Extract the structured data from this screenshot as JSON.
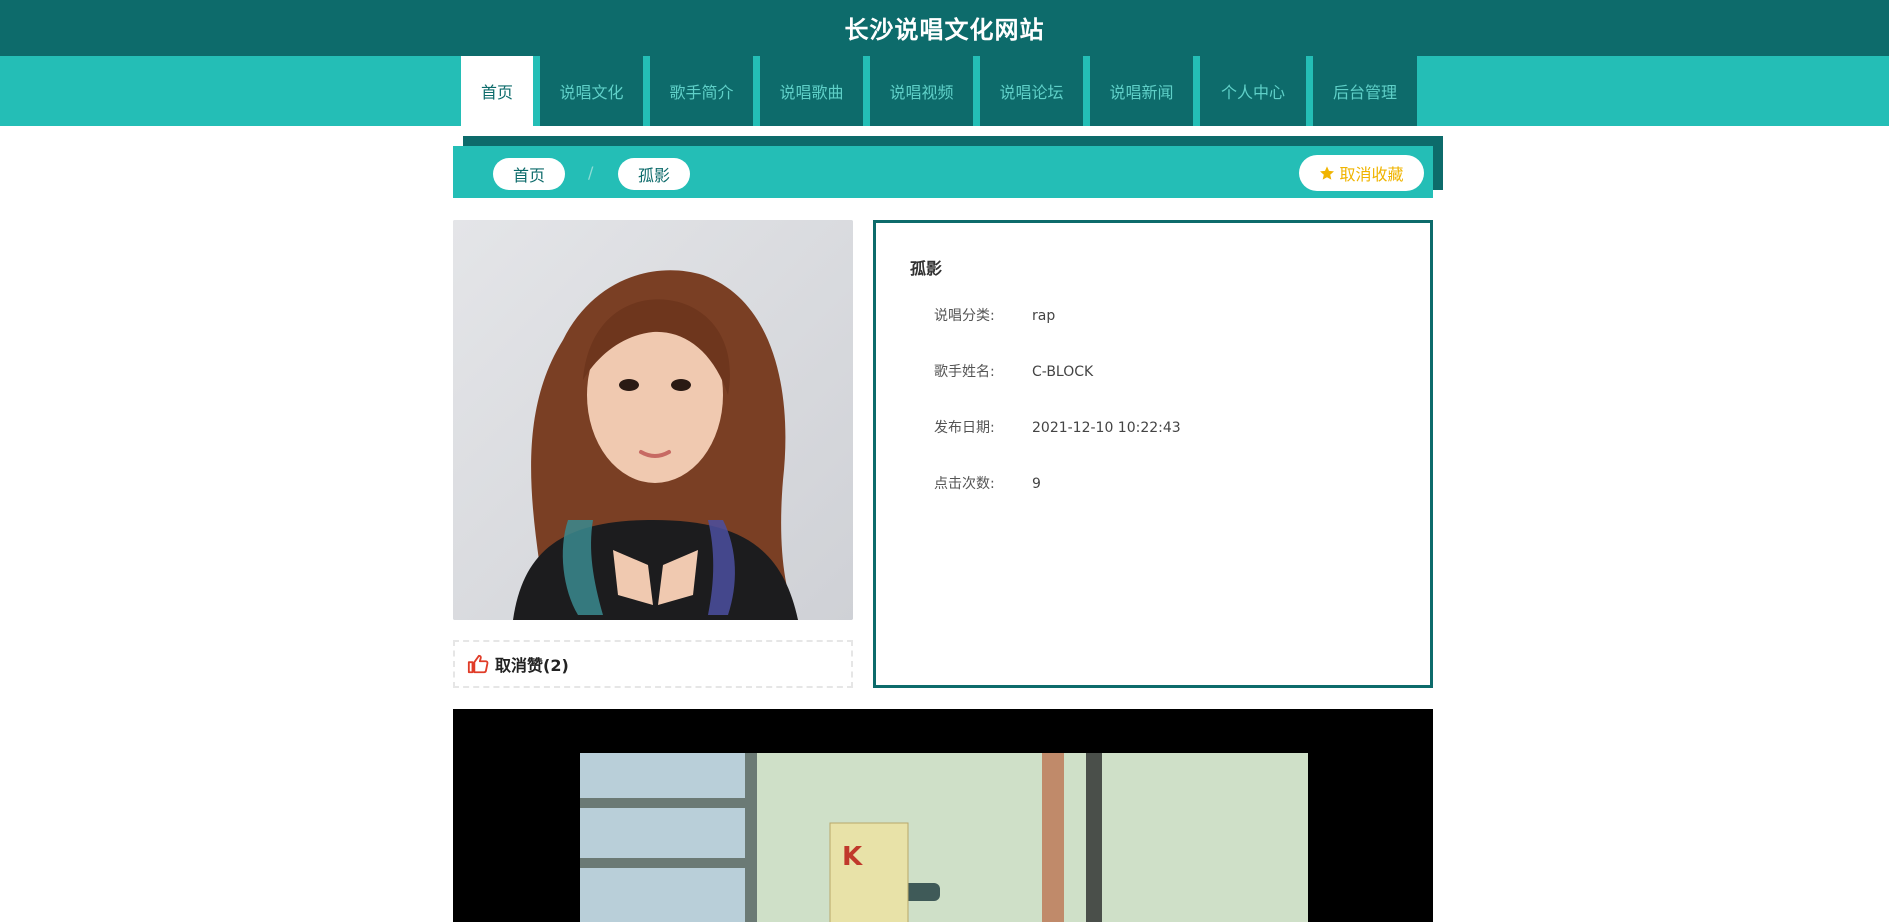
{
  "site": {
    "title": "长沙说唱文化网站"
  },
  "nav": {
    "items": [
      {
        "label": "首页",
        "active": true
      },
      {
        "label": "说唱文化",
        "active": false
      },
      {
        "label": "歌手简介",
        "active": false
      },
      {
        "label": "说唱歌曲",
        "active": false
      },
      {
        "label": "说唱视频",
        "active": false
      },
      {
        "label": "说唱论坛",
        "active": false
      },
      {
        "label": "说唱新闻",
        "active": false
      },
      {
        "label": "个人中心",
        "active": false
      },
      {
        "label": "后台管理",
        "active": false
      }
    ]
  },
  "breadcrumb": {
    "home": "首页",
    "separator": "/",
    "current": "孤影"
  },
  "favorite": {
    "label": "取消收藏",
    "icon": "star-icon"
  },
  "like": {
    "label": "取消赞(2)",
    "icon": "thumbs-up-icon"
  },
  "detail": {
    "title": "孤影",
    "fields": [
      {
        "label": "说唱分类:",
        "value": "rap"
      },
      {
        "label": "歌手姓名:",
        "value": "C-BLOCK"
      },
      {
        "label": "发布日期:",
        "value": "2021-12-10 10:22:43"
      },
      {
        "label": "点击次数:",
        "value": "9"
      }
    ]
  },
  "colors": {
    "primary_dark": "#0d6b6b",
    "primary": "#24beb6",
    "favorite": "#f0b400",
    "like": "#e03c28"
  }
}
